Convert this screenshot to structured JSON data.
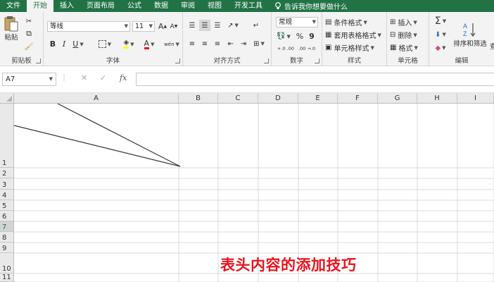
{
  "tabs": [
    "文件",
    "开始",
    "插入",
    "页面布局",
    "公式",
    "数据",
    "审阅",
    "视图",
    "开发工具"
  ],
  "active_tab": "开始",
  "tell_me": "告诉我你想要做什么",
  "clipboard": {
    "paste": "粘贴",
    "label": "剪贴板"
  },
  "font": {
    "name": "等线",
    "size": "11",
    "label": "字体",
    "bold": "B",
    "italic": "I",
    "underline": "U",
    "grow": "A",
    "shrink": "A",
    "font_color": "A",
    "wen": "wén"
  },
  "alignment": {
    "label": "对齐方式"
  },
  "number": {
    "format": "常规",
    "label": "数字",
    "percent": "%",
    "comma": "9",
    "inc": "+.0 .00",
    "dec": ".00 →.0"
  },
  "styles": {
    "conditional": "条件格式",
    "table": "套用表格格式",
    "cell": "单元格样式",
    "label": "样式"
  },
  "cells": {
    "insert": "插入",
    "delete": "删除",
    "format": "格式",
    "label": "单元格"
  },
  "editing": {
    "sort": "排序和筛选",
    "find": "查",
    "label": "编辑"
  },
  "formula_bar": {
    "name_box": "A7",
    "cancel": "✕",
    "enter": "✓",
    "fx": "fx",
    "value": ""
  },
  "columns": [
    "A",
    "B",
    "C",
    "D",
    "E",
    "F",
    "G",
    "H",
    "I"
  ],
  "rows": [
    "1",
    "2",
    "3",
    "4",
    "5",
    "6",
    "7",
    "8",
    "9",
    "10",
    "11"
  ],
  "caption": "表头内容的添加技巧",
  "colors": {
    "accent": "#217346",
    "caption": "#e8141e"
  }
}
